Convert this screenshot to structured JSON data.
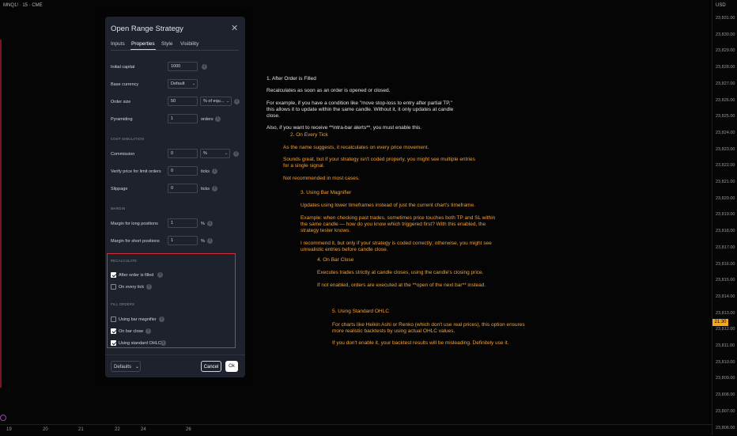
{
  "chart": {
    "symbol": "MNQ1! · 15 · CME",
    "currency": "USD",
    "price_ticks": [
      "23,831.00",
      "23,830.00",
      "23,829.00",
      "23,828.00",
      "23,827.00",
      "23,826.00",
      "23,825.00",
      "23,824.00",
      "23,823.00",
      "23,822.00",
      "23,821.00",
      "23,820.00",
      "23,819.00",
      "23,818.00",
      "23,817.00",
      "23,816.00",
      "23,815.00",
      "23,814.00",
      "23,813.00",
      "23,812.00",
      "23,811.00",
      "23,810.00",
      "23,809.00",
      "23,808.00",
      "23,807.00",
      "23,806.00"
    ],
    "price_badge": "21:30",
    "time_labels": [
      "19",
      "20",
      "21",
      "22",
      "24",
      "26"
    ],
    "colors": {
      "accent_orange": "#f5a623",
      "highlight_red": "#d32f3a"
    }
  },
  "dialog": {
    "title": "Open Range Strategy",
    "close_icon": "close-icon",
    "tabs": [
      {
        "label": "Inputs"
      },
      {
        "label": "Properties"
      },
      {
        "label": "Style"
      },
      {
        "label": "Visibility"
      }
    ],
    "active_tab": "Properties",
    "initial_capital": {
      "label": "Initial capital",
      "value": "1000"
    },
    "base_currency": {
      "label": "Base currency",
      "value": "Default"
    },
    "order_size": {
      "label": "Order size",
      "value": "50",
      "unit": "% of equ..."
    },
    "pyramiding": {
      "label": "Pyramiding",
      "value": "1",
      "unit": "orders"
    },
    "cost_section": "COST SIMULATION",
    "commission": {
      "label": "Commission",
      "value": "0",
      "unit": "%"
    },
    "verify_price": {
      "label": "Verify price for limit orders",
      "value": "0",
      "unit": "ticks"
    },
    "slippage": {
      "label": "Slippage",
      "value": "0",
      "unit": "ticks"
    },
    "margin_section": "MARGIN",
    "margin_long": {
      "label": "Margin for long positions",
      "value": "1",
      "unit": "%"
    },
    "margin_short": {
      "label": "Margin for short positions",
      "value": "1",
      "unit": "%"
    },
    "recalculate_section": "RECALCULATE",
    "after_order_filled": {
      "label": "After order is filled",
      "checked": true
    },
    "on_every_tick": {
      "label": "On every tick",
      "checked": false
    },
    "fill_section": "FILL ORDERS",
    "bar_magnifier": {
      "label": "Using bar magnifier",
      "checked": false
    },
    "on_bar_close": {
      "label": "On bar close",
      "checked": true
    },
    "standard_ohlc": {
      "label": "Using standard OHLC",
      "checked": true
    },
    "defaults_label": "Defaults",
    "cancel_label": "Cancel",
    "ok_label": "Ok"
  },
  "annotations": {
    "s1": {
      "title": "1. After Order is Filled",
      "p1": "Recalculates as soon as an order is opened or closed.",
      "p2a": "For example, if you have a condition like \"move stop-loss to entry after partial TP,\"",
      "p2b": "this allows it to update within the same candle. Without it, it only updates at candle",
      "p2c": "close.",
      "p3": "Also, if you want to receive **intra-bar alerts**, you must enable this."
    },
    "s2": {
      "title": "2. On Every Tick",
      "p1": "As the name suggests, it recalculates on every price movement.",
      "p2a": "Sounds great, but if your strategy isn't coded properly, you might see multiple entries",
      "p2b": "for a single signal.",
      "p3": "Not recommended in most cases."
    },
    "s3": {
      "title": "3. Using Bar Magnifier",
      "p1": "Updates using lower timeframes instead of just the current chart's timeframe.",
      "p2a": "Example: when checking past trades, sometimes price touches both TP and SL within",
      "p2b": "the same candle — how do you know which triggered first? With this enabled, the",
      "p2c": "strategy tester knows.",
      "p3a": "I recommend it, but only if your strategy is coded correctly; otherwise, you might see",
      "p3b": "unrealistic entries before candle close."
    },
    "s4": {
      "title": "4. On Bar Close",
      "p1": "Executes trades strictly at candle closes, using the candle's closing price.",
      "p2": "If not enabled, orders are executed at the **open of the next bar** instead."
    },
    "s5": {
      "title": "5. Using Standard OHLC",
      "p1a": "For charts like Heikin Ashi or Renko (which don't use real prices), this option ensures",
      "p1b": "more realistic backtests by using actual OHLC values.",
      "p2": "If you don't enable it, your backtest results will be misleading. Definitely use it."
    }
  }
}
